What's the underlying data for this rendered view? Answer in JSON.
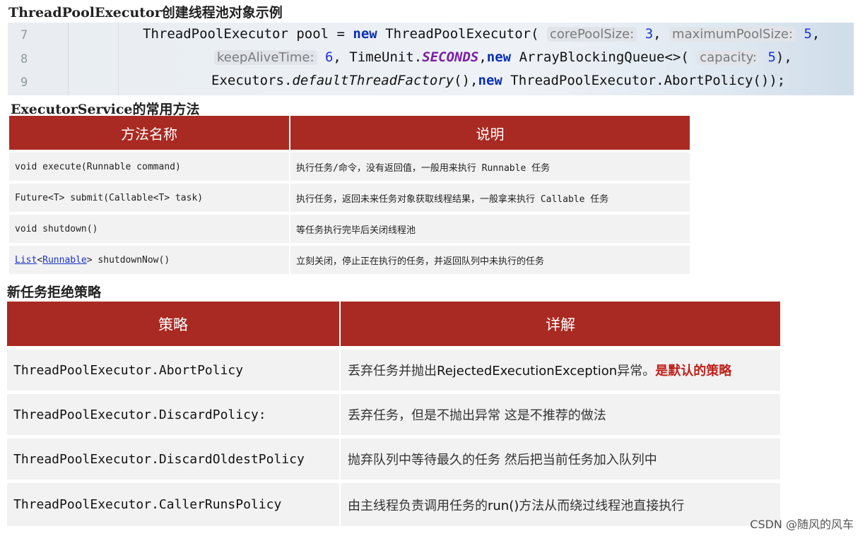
{
  "title_1": {
    "en": "ThreadPoolExecutor",
    "zh": "创建线程池对象示例"
  },
  "code": {
    "line_numbers": [
      "7",
      "8",
      "9"
    ],
    "l7": {
      "a": "ThreadPoolExecutor pool = ",
      "kw_new": "new",
      "b": " ThreadPoolExecutor(",
      "hint_core": "corePoolSize:",
      "num_core": "3",
      "comma1": ",",
      "hint_max": "maximumPoolSize:",
      "num_max": "5",
      "comma2": ","
    },
    "l8": {
      "hint_keep": "keepAliveTime:",
      "num_keep": "6",
      "a": ", TimeUnit.",
      "const_seconds": "SECONDS",
      "comma": ",",
      "kw_new": "new",
      "b": " ArrayBlockingQueue<>(",
      "hint_cap": "capacity:",
      "num_cap": "5",
      "c": "),"
    },
    "l9": {
      "a": "Executors.",
      "method": "defaultThreadFactory",
      "b": "(),",
      "kw_new": "new",
      "c": " ThreadPoolExecutor.AbortPolicy());"
    }
  },
  "title_2": {
    "en": "ExecutorService",
    "zh": "的常用方法"
  },
  "methods_table": {
    "headers": [
      "方法名称",
      "说明"
    ],
    "rows": [
      {
        "method": "void execute(Runnable command)",
        "desc": "执行任务/命令，没有返回值，一般用来执行 Runnable 任务"
      },
      {
        "method": "Future<T> submit(Callable<T> task)",
        "desc": "执行任务，返回未来任务对象获取线程结果，一般拿来执行 Callable 任务"
      },
      {
        "method": "void shutdown()",
        "desc": "等任务执行完毕后关闭线程池"
      },
      {
        "method_link1": "List",
        "method_lt": "<",
        "method_link2": "Runnable",
        "method_rest": "> shutdownNow()",
        "desc": "立刻关闭，停止正在执行的任务，并返回队列中未执行的任务"
      }
    ]
  },
  "title_3": "新任务拒绝策略",
  "policy_table": {
    "headers": [
      "策略",
      "详解"
    ],
    "rows": [
      {
        "policy": "ThreadPoolExecutor.AbortPolicy",
        "desc_a": "丢弃任务并抛出",
        "desc_b": "RejectedExecutionException",
        "desc_c": "异常。",
        "desc_emph": "是默认的策略"
      },
      {
        "policy": "ThreadPoolExecutor.DiscardPolicy:",
        "desc": "丢弃任务，但是不抛出异常 这是不推荐的做法"
      },
      {
        "policy": "ThreadPoolExecutor.DiscardOldestPolicy",
        "desc": "抛弃队列中等待最久的任务 然后把当前任务加入队列中"
      },
      {
        "policy": "ThreadPoolExecutor.CallerRunsPolicy",
        "desc_a": "由主线程负责调用任务的",
        "desc_b": "run()",
        "desc_c": "方法从而绕过线程池直接执行"
      }
    ]
  },
  "watermark": "CSDN @随风的风车",
  "colors": {
    "header_bg": "#a92a22",
    "row_bg": "#f2f2f2",
    "emphasis": "#c0201a",
    "keyword": "#0a2fb0"
  }
}
